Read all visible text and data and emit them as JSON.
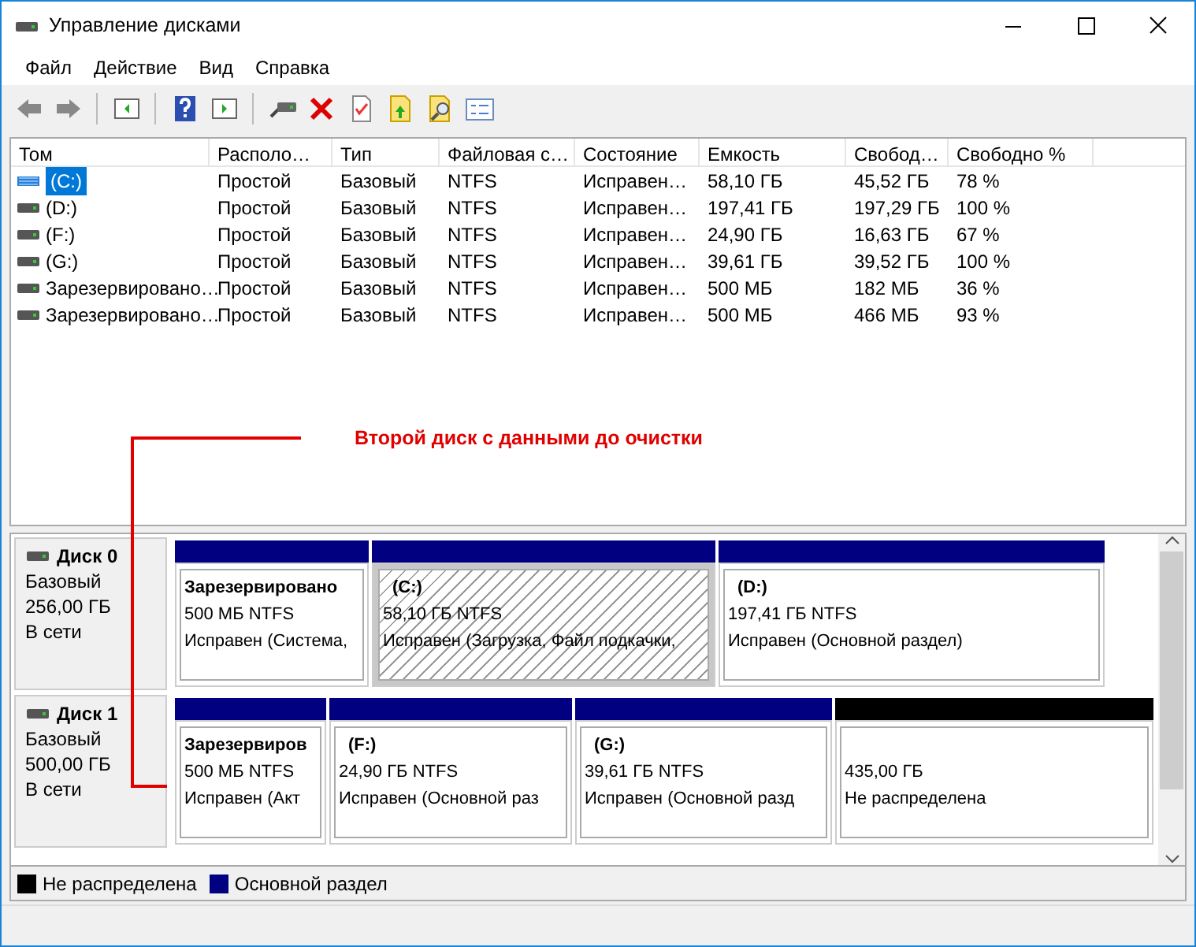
{
  "window": {
    "title": "Управление дисками"
  },
  "menu": [
    "Файл",
    "Действие",
    "Вид",
    "Справка"
  ],
  "table": {
    "columns": [
      "Том",
      "Располо…",
      "Тип",
      "Файловая с…",
      "Состояние",
      "Емкость",
      "Свобод…",
      "Свободно %"
    ],
    "rows": [
      {
        "selected": true,
        "cells": [
          "(C:)",
          "Простой",
          "Базовый",
          "NTFS",
          "Исправен…",
          "58,10 ГБ",
          "45,52 ГБ",
          "78 %"
        ]
      },
      {
        "selected": false,
        "cells": [
          "(D:)",
          "Простой",
          "Базовый",
          "NTFS",
          "Исправен…",
          "197,41 ГБ",
          "197,29 ГБ",
          "100 %"
        ]
      },
      {
        "selected": false,
        "cells": [
          "(F:)",
          "Простой",
          "Базовый",
          "NTFS",
          "Исправен…",
          "24,90 ГБ",
          "16,63 ГБ",
          "67 %"
        ]
      },
      {
        "selected": false,
        "cells": [
          "(G:)",
          "Простой",
          "Базовый",
          "NTFS",
          "Исправен…",
          "39,61 ГБ",
          "39,52 ГБ",
          "100 %"
        ]
      },
      {
        "selected": false,
        "cells": [
          "Зарезервировано…",
          "Простой",
          "Базовый",
          "NTFS",
          "Исправен…",
          "500 МБ",
          "182 МБ",
          "36 %"
        ]
      },
      {
        "selected": false,
        "cells": [
          "Зарезервировано…",
          "Простой",
          "Базовый",
          "NTFS",
          "Исправен…",
          "500 МБ",
          "466 МБ",
          "93 %"
        ]
      }
    ]
  },
  "annotation": {
    "text": "Второй диск с данными до очистки"
  },
  "disks": [
    {
      "name": "Диск 0",
      "type": "Базовый",
      "size": "256,00 ГБ",
      "status": "В сети",
      "partitions": [
        {
          "kind": "primary",
          "selected": false,
          "name": "Зарезервировано",
          "size": "500 МБ NTFS",
          "status": "Исправен (Система,"
        },
        {
          "kind": "primary",
          "selected": true,
          "name": "(C:)",
          "size": "58,10 ГБ NTFS",
          "status": "Исправен (Загрузка, Файл подкачки,"
        },
        {
          "kind": "primary",
          "selected": false,
          "name": "(D:)",
          "size": "197,41 ГБ NTFS",
          "status": "Исправен (Основной раздел)"
        }
      ]
    },
    {
      "name": "Диск 1",
      "type": "Базовый",
      "size": "500,00 ГБ",
      "status": "В сети",
      "partitions": [
        {
          "kind": "primary",
          "selected": false,
          "name": "Зарезервиров",
          "size": "500 МБ NTFS",
          "status": "Исправен (Акт"
        },
        {
          "kind": "primary",
          "selected": false,
          "name": "(F:)",
          "size": "24,90 ГБ NTFS",
          "status": "Исправен (Основной раз"
        },
        {
          "kind": "primary",
          "selected": false,
          "name": "(G:)",
          "size": "39,61 ГБ NTFS",
          "status": "Исправен (Основной разд"
        },
        {
          "kind": "unallocated",
          "selected": false,
          "size": "435,00 ГБ",
          "status": "Не распределена"
        }
      ]
    }
  ],
  "legend": [
    {
      "label": "Не распределена",
      "color": "#000000"
    },
    {
      "label": "Основной раздел",
      "color": "#000080"
    }
  ]
}
